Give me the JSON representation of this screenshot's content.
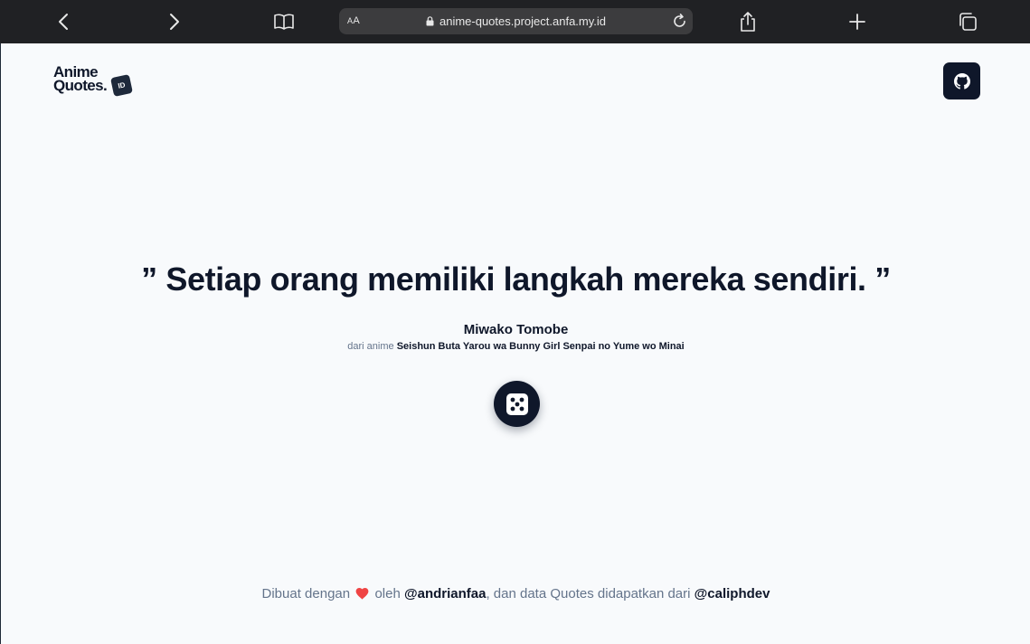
{
  "browser": {
    "url": "anime-quotes.project.anfa.my.id",
    "reader_label_big": "A",
    "reader_label_small": "A",
    "icons": [
      "back-arrow-icon",
      "forward-arrow-icon",
      "bookmarks-book-icon",
      "lock-icon",
      "reload-icon",
      "share-icon",
      "new-tab-plus-icon",
      "tabs-overview-icon"
    ]
  },
  "header": {
    "logo_line1": "Anime",
    "logo_line2": "Quotes.",
    "logo_badge": "ID",
    "github_icon": "github-icon"
  },
  "quote": {
    "text": "” Setiap orang memiliki langkah mereka sendiri. ”",
    "character": "Miwako Tomobe",
    "anime_prefix": "dari anime",
    "anime": "Seishun Buta Yarou wa Bunny Girl Senpai no Yume wo Minai"
  },
  "random_button": {
    "icon": "dice-icon"
  },
  "footer": {
    "made_with": "Dibuat dengan",
    "by": "oleh",
    "author": "@andrianfaa",
    "data_source_text": ", dan data Quotes didapatkan dari",
    "source": "@caliphdev",
    "heart_icon": "heart-icon"
  },
  "colors": {
    "chrome_bg": "#202124",
    "page_bg": "#f8fafc",
    "primary": "#0f172a",
    "muted": "#64748b",
    "heart": "#ef4444"
  }
}
